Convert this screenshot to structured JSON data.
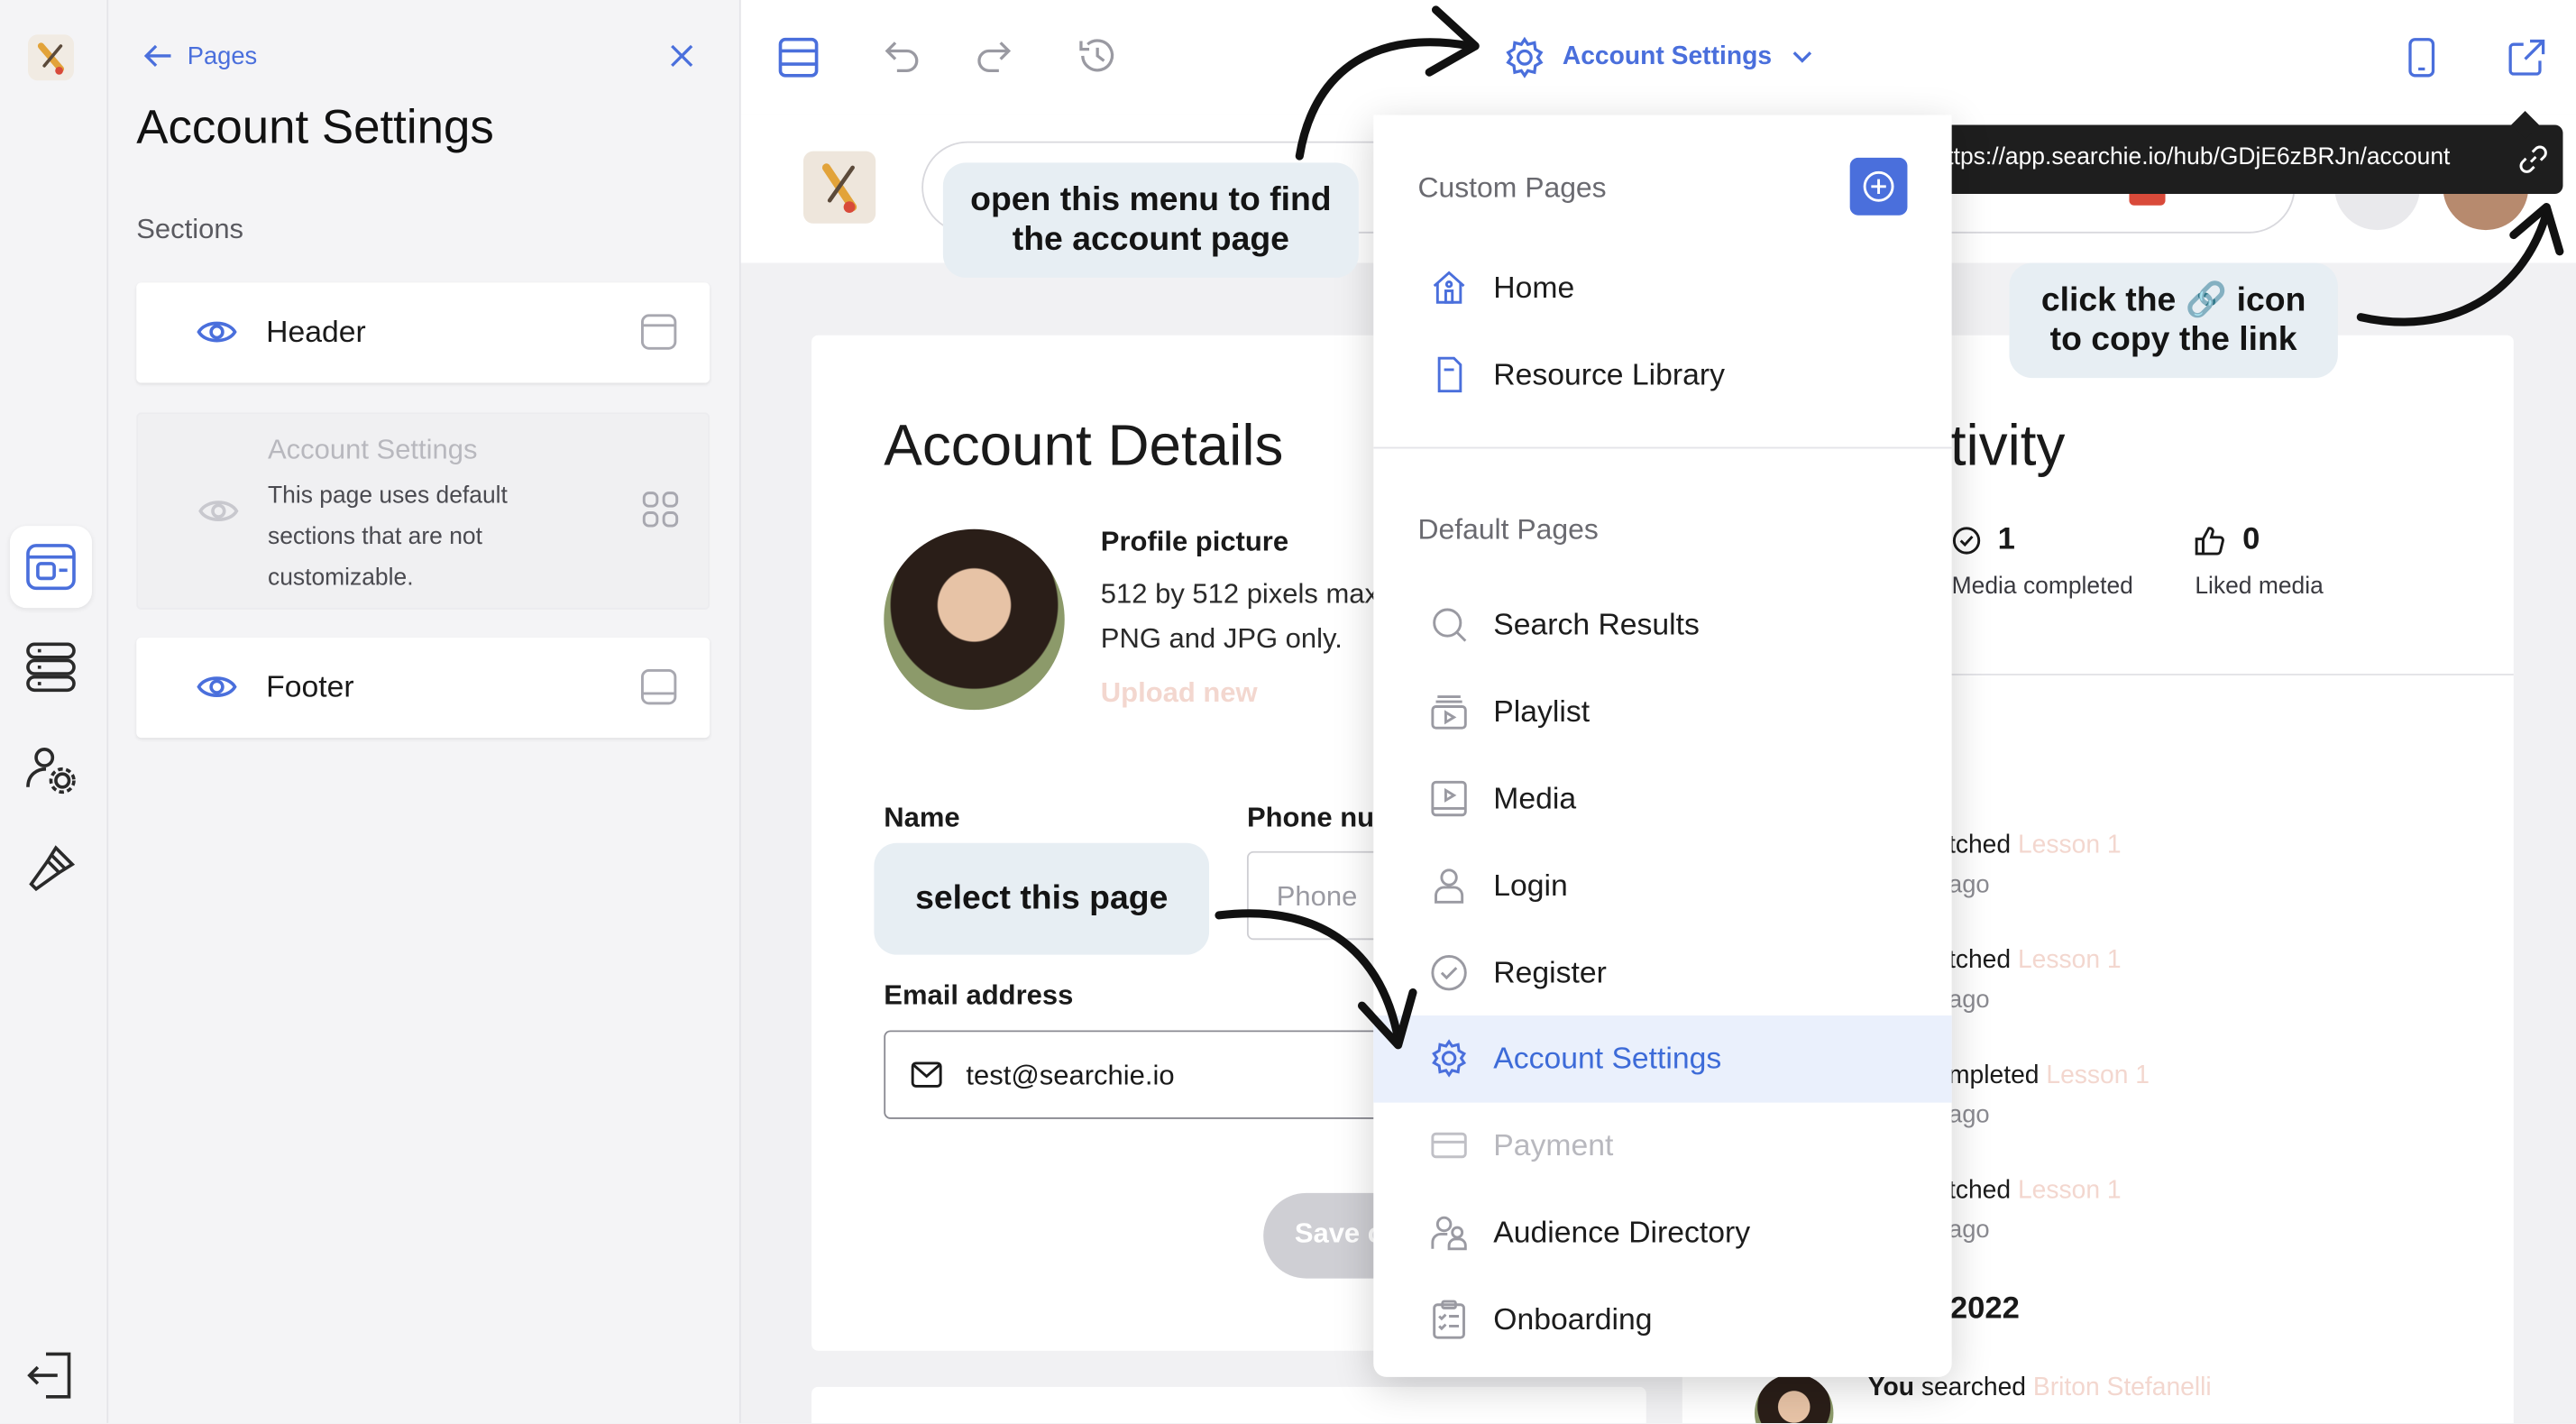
{
  "rail": {
    "items": [
      {
        "icon": "app-logo-icon"
      },
      {
        "icon": "layout-icon"
      },
      {
        "icon": "layers-list-icon"
      },
      {
        "icon": "users-settings-icon"
      },
      {
        "icon": "brush-icon"
      },
      {
        "icon": "exit-icon"
      }
    ]
  },
  "panel": {
    "back_label": "Pages",
    "title": "Account Settings",
    "sections_label": "Sections",
    "sections": [
      {
        "name": "Header",
        "icon": "eye-icon",
        "type_icon": "header-layout-icon"
      },
      {
        "name": "Account Settings",
        "description": "This page uses default sections that are not customizable.",
        "disabled": true
      },
      {
        "name": "Footer",
        "icon": "eye-icon",
        "type_icon": "footer-layout-icon"
      }
    ]
  },
  "toolbar": {
    "page_selector_label": "Account Settings"
  },
  "url_tooltip": {
    "url": "https://app.searchie.io/hub/GDjE6zBRJn/account"
  },
  "annotations": {
    "open_menu": "open this menu to find the account page",
    "copy_link_line1": "click the 🔗 icon",
    "copy_link_line2": "to copy the link",
    "select_page": "select this page"
  },
  "account_details": {
    "title": "Account Details",
    "profile_picture_label": "Profile picture",
    "profile_hint_1": "512 by 512 pixels max",
    "profile_hint_2": "PNG and JPG only.",
    "upload_label": "Upload new",
    "name_label": "Name",
    "phone_label": "Phone nu",
    "phone_placeholder": "Phone",
    "email_label": "Email address",
    "email_value": "test@searchie.io",
    "save_label": "Save c"
  },
  "activity": {
    "title": "tivity",
    "stats": [
      {
        "value": "1",
        "label": "Media completed"
      },
      {
        "value": "0",
        "label": "Liked media"
      }
    ],
    "entries": [
      {
        "action": "tched",
        "target": "Lesson 1",
        "time": "ago"
      },
      {
        "action": "tched",
        "target": "Lesson 1",
        "time": "ago"
      },
      {
        "action": "mpleted",
        "target": "Lesson 1",
        "time": "ago"
      },
      {
        "action": "tched",
        "target": "Lesson 1",
        "time": "ago"
      }
    ],
    "year_label": "2022",
    "last_entry_actor": "You",
    "last_entry_action": "searched",
    "last_entry_target": "Briton Stefanelli"
  },
  "dropdown": {
    "custom_heading": "Custom Pages",
    "custom_pages": [
      {
        "label": "Home",
        "icon": "home-icon"
      },
      {
        "label": "Resource Library",
        "icon": "document-icon"
      }
    ],
    "default_heading": "Default Pages",
    "default_pages": [
      {
        "label": "Search Results",
        "icon": "search-icon"
      },
      {
        "label": "Playlist",
        "icon": "playlist-icon"
      },
      {
        "label": "Media",
        "icon": "media-icon"
      },
      {
        "label": "Login",
        "icon": "user-icon"
      },
      {
        "label": "Register",
        "icon": "check-circle-icon"
      },
      {
        "label": "Account Settings",
        "icon": "gear-icon",
        "selected": true
      },
      {
        "label": "Payment",
        "icon": "credit-card-icon",
        "disabled": true
      },
      {
        "label": "Audience Directory",
        "icon": "users-icon"
      },
      {
        "label": "Onboarding",
        "icon": "checklist-icon"
      }
    ]
  },
  "colors": {
    "accent": "#4a6fdc",
    "annotation_bg": "#e7eef3",
    "tooltip_bg": "#1e1e1e",
    "selected_bg": "#eaf0fc"
  }
}
